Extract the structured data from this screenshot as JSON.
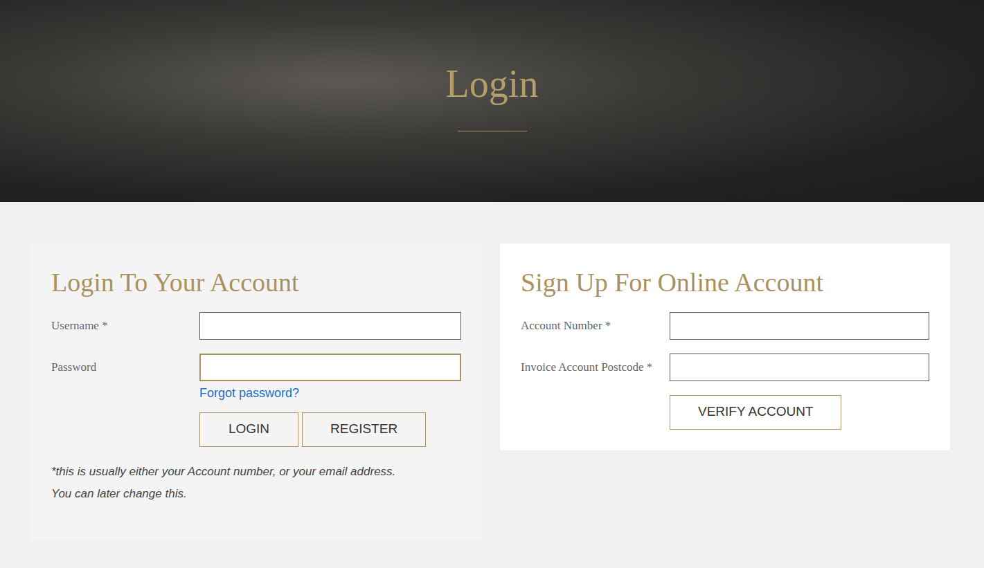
{
  "page": {
    "title": "Login"
  },
  "login": {
    "heading": "Login To Your Account",
    "fields": [
      {
        "label": "Username *",
        "value": "",
        "focused": false
      },
      {
        "label": "Password",
        "value": "",
        "focused": true
      }
    ],
    "forgot": "Forgot password?",
    "buttons": [
      "LOGIN",
      "REGISTER"
    ],
    "note": [
      "*this is usually either your Account number, or your email address.",
      "You can later change this."
    ]
  },
  "signup": {
    "heading": "Sign Up For Online Account",
    "fields": [
      {
        "label": "Account Number *",
        "value": "",
        "focused": false
      },
      {
        "label": "Invoice Account Postcode *",
        "value": "",
        "focused": false
      }
    ],
    "buttons": [
      "VERIFY ACCOUNT"
    ]
  }
}
